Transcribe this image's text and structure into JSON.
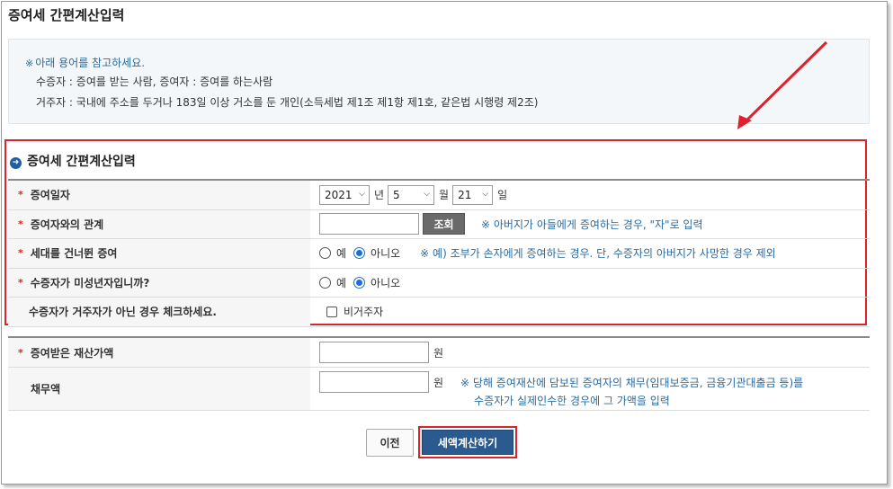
{
  "page": {
    "title": "증여세 간편계산입력"
  },
  "notice": {
    "mark": "※",
    "heading": "아래 용어를 참고하세요.",
    "line1": "수증자 : 증여를 받는 사람, 증여자 : 증여를 하는사람",
    "line2": "거주자 : 국내에 주소를 두거나 183일 이상 거소를 둔 개인(소득세법 제1조 제1항 제1호, 같은법 시행령 제2조)"
  },
  "section": {
    "title": "증여세 간편계산입력",
    "bullet": "➜"
  },
  "form": {
    "required_mark": "*",
    "gift_date": {
      "label": "증여일자",
      "year": "2021",
      "year_unit": "년",
      "month": "5",
      "month_unit": "월",
      "day": "21",
      "day_unit": "일"
    },
    "relation": {
      "label": "증여자와의 관계",
      "value": "",
      "button": "조회",
      "hint": "※ 아버지가 아들에게 증여하는 경우, \"자\"로 입력"
    },
    "generation_skip": {
      "label": "세대를 건너뛴 증여",
      "opt_yes": "예",
      "opt_no": "아니오",
      "selected": "아니오",
      "hint": "※ 예) 조부가 손자에게 증여하는 경우. 단, 수증자의 아버지가 사망한 경우 제외"
    },
    "minor": {
      "label": "수증자가 미성년자입니까?",
      "opt_yes": "예",
      "opt_no": "아니오",
      "selected": "아니오"
    },
    "non_resident": {
      "label": "수증자가 거주자가 아닌 경우 체크하세요.",
      "checkbox_label": "비거주자",
      "checked": false
    },
    "gift_amount": {
      "label": "증여받은 재산가액",
      "value": "",
      "unit": "원"
    },
    "debt": {
      "label": "채무액",
      "value": "",
      "unit": "원",
      "hint_line1": "※ 당해 증여재산에 담보된 증여자의 채무(임대보증금, 금융기관대출금 등)를",
      "hint_line2": "수증자가 실제인수한 경우에 그 가액을 입력"
    }
  },
  "buttons": {
    "prev": "이전",
    "calculate": "세액계산하기"
  },
  "colors": {
    "accent_red": "#d9232d",
    "link_blue": "#2a6a9e",
    "primary_button": "#2a5a8e"
  }
}
